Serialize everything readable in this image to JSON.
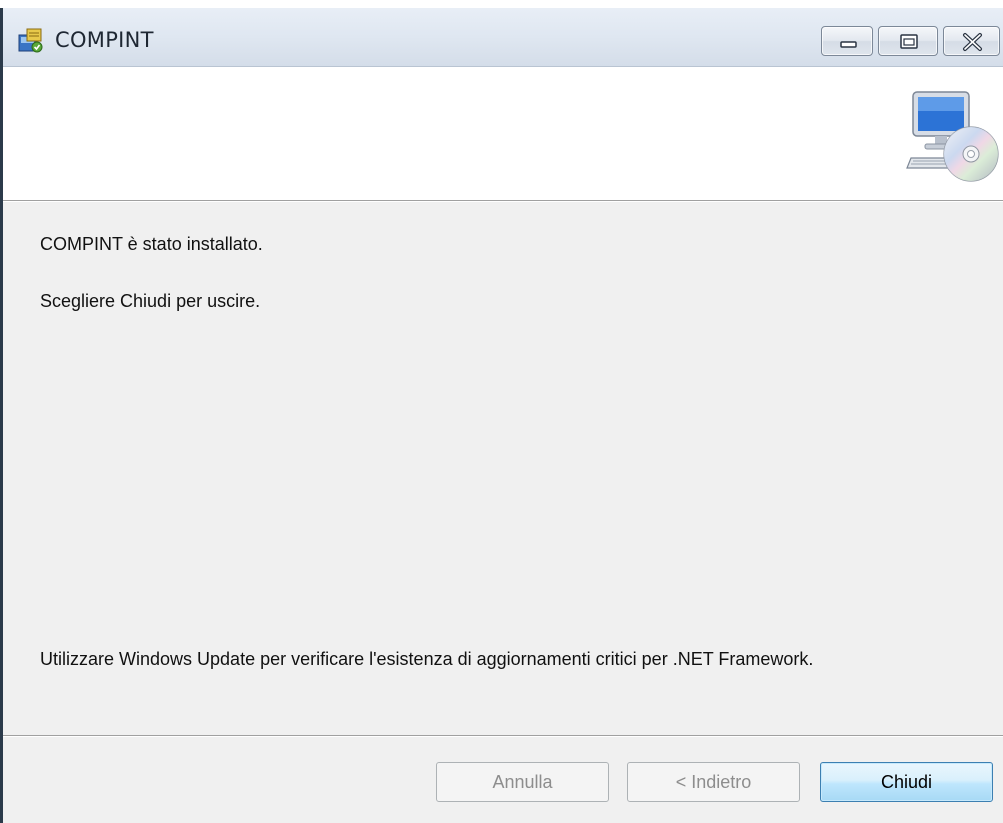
{
  "window": {
    "title": "COMPINT",
    "caption_buttons": {
      "minimize_icon": "minimize-icon",
      "maximize_icon": "maximize-icon",
      "close_icon": "close-icon"
    }
  },
  "banner": {
    "icon": "computer-cd-setup-icon"
  },
  "content": {
    "installed_message": "COMPINT è stato installato.",
    "close_instruction": "Scegliere Chiudi per uscire.",
    "update_notice": "Utilizzare Windows Update per verificare l'esistenza di aggiornamenti critici per .NET Framework."
  },
  "buttons": {
    "cancel_label": "Annulla",
    "back_label": "< Indietro",
    "close_label": "Chiudi",
    "cancel_enabled": false,
    "back_enabled": false,
    "close_enabled": true
  },
  "colors": {
    "accent": "#3c7fb1",
    "disabled_text": "#8d8d8d",
    "dialog_bg": "#f0f0f0"
  }
}
